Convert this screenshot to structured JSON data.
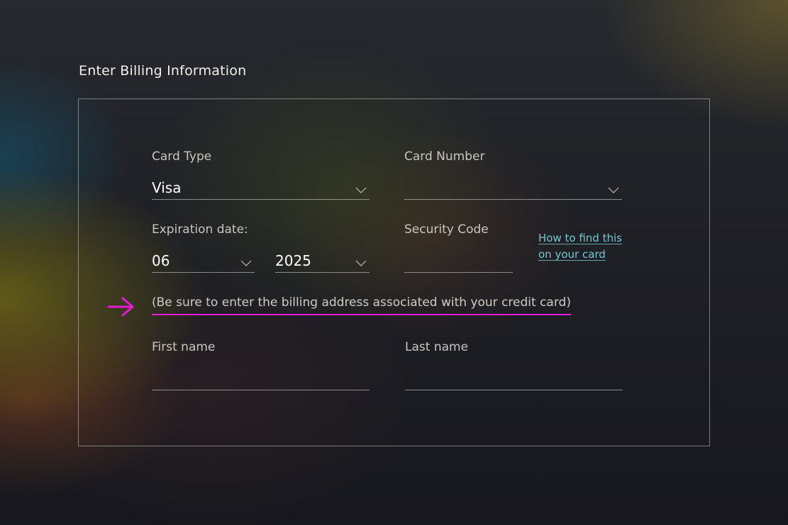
{
  "page": {
    "title": "Enter Billing Information"
  },
  "card": {
    "type_label": "Card Type",
    "type_value": "Visa",
    "number_label": "Card Number",
    "number_value": ""
  },
  "expiration": {
    "label": "Expiration date:",
    "month_value": "06",
    "year_value": "2025"
  },
  "security": {
    "label": "Security Code",
    "value": "",
    "help_line1": "How to find this",
    "help_line2": "on your card"
  },
  "notice": {
    "text": "(Be sure to enter the billing address associated with your credit card)"
  },
  "name": {
    "first_label": "First name",
    "first_value": "",
    "last_label": "Last name",
    "last_value": ""
  },
  "colors": {
    "accent_highlight": "#e51ad6",
    "link": "#74c7d0"
  },
  "icons": {
    "dropdown": "chevron-down-icon",
    "pointer": "arrow-right-icon"
  }
}
